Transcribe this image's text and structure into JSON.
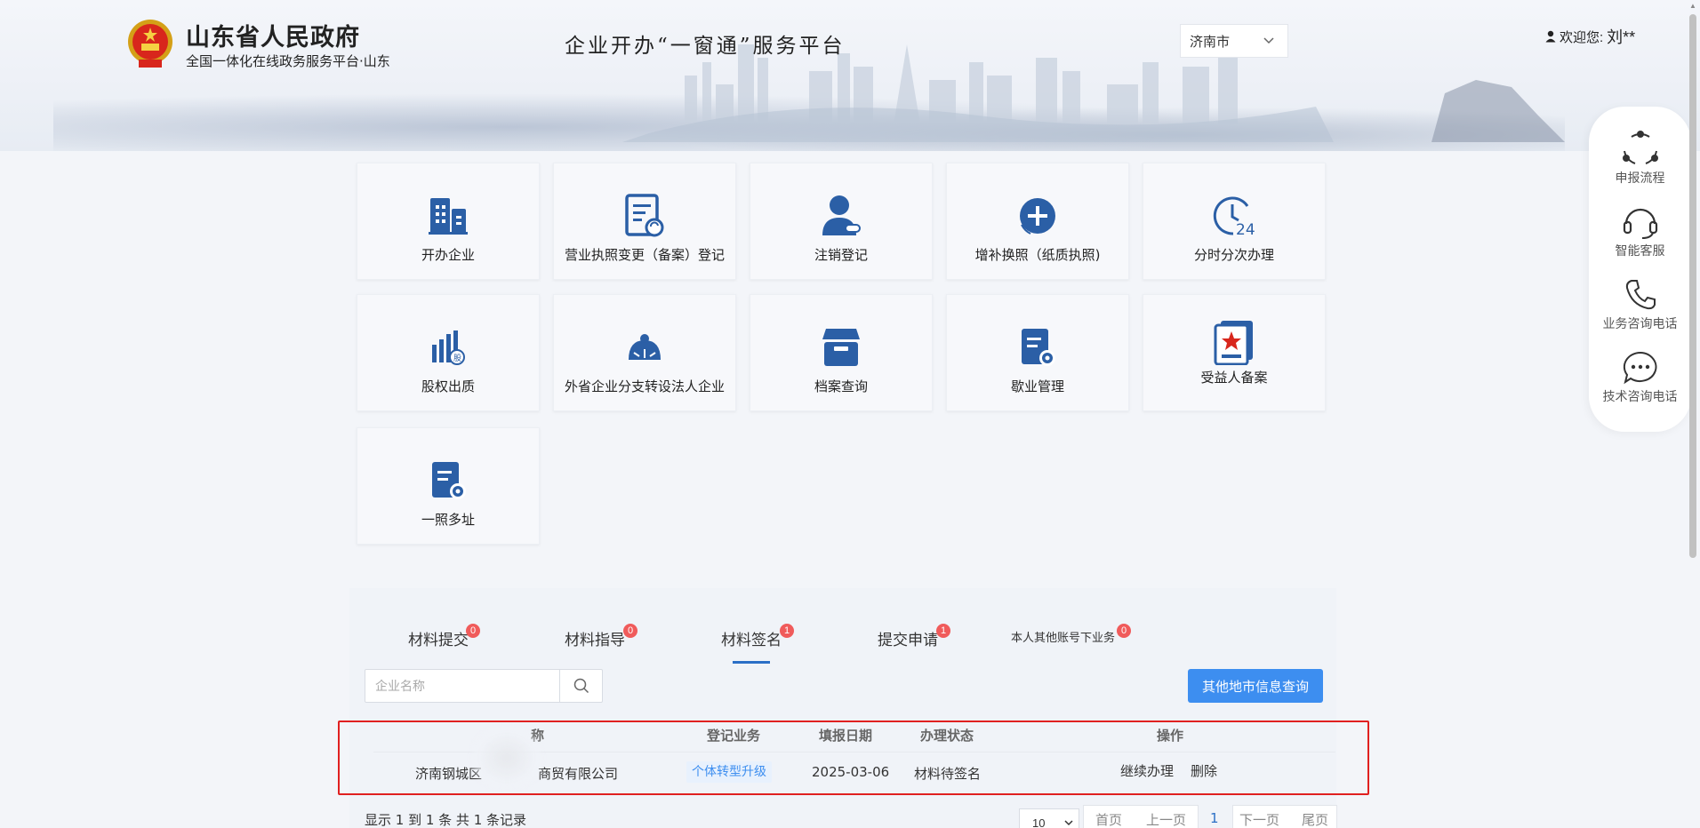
{
  "header": {
    "gov_title": "山东省人民政府",
    "gov_subtitle": "全国一体化在线政务服务平台·山东",
    "platform_title": "企业开办“一窗通”服务平台",
    "city": "济南市",
    "welcome_label": "欢迎您:",
    "user_name": "刘**"
  },
  "tiles": [
    {
      "label": "开办企业",
      "icon": "building-icon"
    },
    {
      "label": "营业执照变更（备案）登记",
      "icon": "document-refresh-icon"
    },
    {
      "label": "注销登记",
      "icon": "user-minus-icon"
    },
    {
      "label": "增补换照（纸质执照)",
      "icon": "plus-circle-icon"
    },
    {
      "label": "分时分次办理",
      "icon": "clock-24-icon"
    },
    {
      "label": "股权出质",
      "icon": "equity-chart-icon"
    },
    {
      "label": "外省企业分支转设法人企业",
      "icon": "branch-transfer-icon"
    },
    {
      "label": "档案查询",
      "icon": "archive-box-icon"
    },
    {
      "label": "歇业管理",
      "icon": "document-settings-icon"
    },
    {
      "label": "受益人备案",
      "icon": "beneficiary-certificate-icon"
    },
    {
      "label": "一照多址",
      "icon": "multi-address-icon"
    }
  ],
  "side_float": {
    "items": [
      {
        "label": "申报流程",
        "icon": "process-cycle-icon"
      },
      {
        "label": "智能客服",
        "icon": "headset-icon"
      },
      {
        "label": "业务咨询电话",
        "icon": "phone-icon"
      },
      {
        "label": "技术咨询电话",
        "icon": "chat-bubble-icon"
      }
    ]
  },
  "tabs": [
    {
      "label": "材料提交",
      "badge": "0"
    },
    {
      "label": "材料指导",
      "badge": "0"
    },
    {
      "label": "材料签名",
      "badge": "1",
      "active": true
    },
    {
      "label": "提交申请",
      "badge": "1"
    },
    {
      "label": "本人其他账号下业务",
      "badge": "0"
    }
  ],
  "search": {
    "placeholder": "企业名称",
    "value": ""
  },
  "query_button": "其他地市信息查询",
  "table": {
    "headers": {
      "name": "称",
      "business": "登记业务",
      "date": "填报日期",
      "status": "办理状态",
      "actions": "操作"
    },
    "rows": [
      {
        "name_part1": "济南钢城区",
        "name_part2": "商贸有限公司",
        "business": "个体转型升级",
        "date": "2025-03-06",
        "status": "材料待签名",
        "action_continue": "继续办理",
        "action_delete": "删除"
      }
    ]
  },
  "pagination": {
    "summary": "显示 1 到 1 条 共 1 条记录",
    "page_size": "10",
    "first": "首页",
    "prev": "上一页",
    "current": "1",
    "next": "下一页",
    "last": "尾页"
  },
  "colors": {
    "accent": "#3d8ef0",
    "icon_blue": "#2b5fa6",
    "badge_red": "#f05b5b",
    "highlight_red": "#e02020"
  }
}
